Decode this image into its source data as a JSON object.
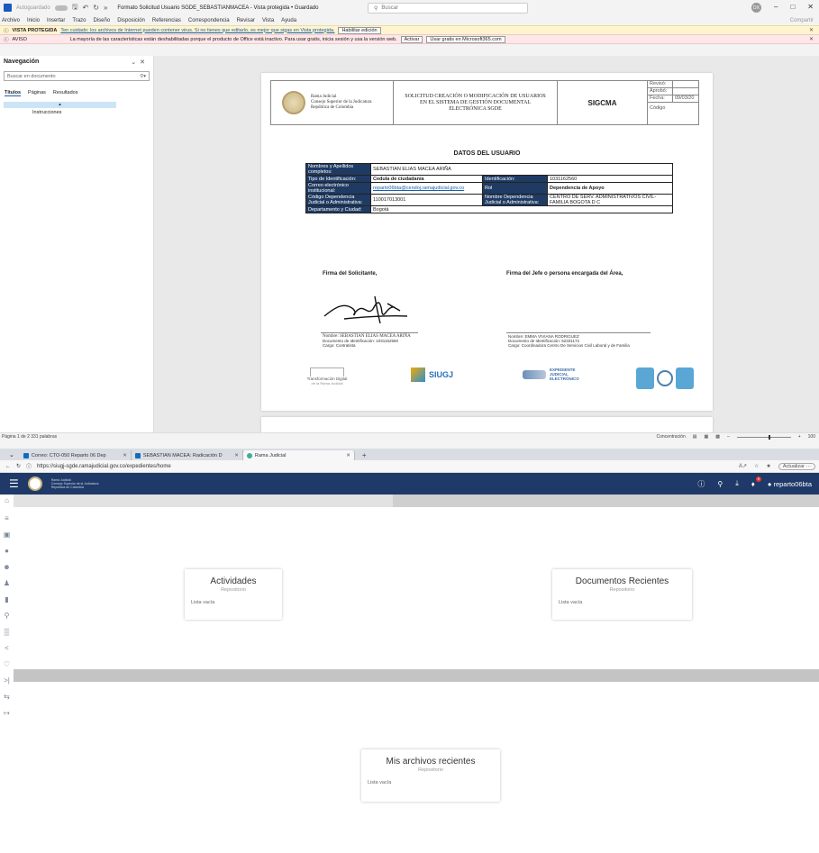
{
  "word": {
    "autosave_label": "Autoguardado",
    "doc_title": "Formato Solicitud Usuario SGDE_SEBASTIANMACEA  -  Vista protegida • Guardado",
    "search_placeholder": "Buscar",
    "avatar_initials": "DX",
    "menu": [
      "Archivo",
      "Inicio",
      "Insertar",
      "Trazo",
      "Diseño",
      "Disposición",
      "Referencias",
      "Correspondencia",
      "Revisar",
      "Vista",
      "Ayuda"
    ],
    "share_label": "Compartir",
    "protected_bar": {
      "tag": "VISTA PROTEGIDA",
      "text": "Ten cuidado: los archivos de Internet pueden contener virus. Si no tienes que editarlo, es mejor que sigas en Vista protegida.",
      "button": "Habilitar edición"
    },
    "notice_bar": {
      "tag": "AVISO",
      "text": "La mayoría de las características están deshabilitadas porque el producto de Office está inactivo. Para usar gratis, inicia sesión y usa la versión web.",
      "btn1": "Activar",
      "btn2": "Usar gratis en Microsoft365.com"
    },
    "nav": {
      "title": "Navegación",
      "search_placeholder": "Buscar en documento",
      "tabs": [
        "Títulos",
        "Páginas",
        "Resultados"
      ],
      "item": "Instrucciones"
    },
    "status": {
      "left": "Página 1 de 2    331 palabras",
      "focus": "Concentración",
      "zoom": "100"
    }
  },
  "document": {
    "entity": [
      "Rama Judicial",
      "Consejo Superior de la Judicatura",
      "República de Colombia"
    ],
    "form_title": "SOLICITUD CREACIÓN O MODIFICACIÓN DE USUARIOS EN EL SISTEMA DE GESTIÓN DOCUMENTAL ELECTRÓNICA SGDE",
    "system": "SIGCMA",
    "meta": {
      "reviso": "Revisó:",
      "aprobo": "Aprobó:",
      "fecha_label": "Fecha:",
      "fecha": "09/03/20",
      "codigo": "Código"
    },
    "section_title": "DATOS DEL USUARIO",
    "table": {
      "nombres_lbl": "Nombres y Apellidos completos:",
      "nombres": "SEBASTIAN ELIAS MACEA ARIÑA",
      "tipo_lbl": "Tipo de Identificación:",
      "tipo": "Cedula de ciudadanía",
      "ident_lbl": "Identificación:",
      "ident": "1031162560",
      "correo_lbl": "Correo electrónico institucional:",
      "correo": "reparto06bta@cendoj.ramajudicial.gov.co",
      "rol_lbl": "Rol",
      "rol": "Dependencia de Apoyo",
      "cod_lbl": "Código Dependencia Judicial o Administrativa:",
      "cod": "110017013001",
      "nomdep_lbl": "Nombre Dependencia Judicial o Administrativa:",
      "nomdep": "CENTRO DE SERV. ADMINISTRATIVOS CIVIL-FAMILIA BOGOTA D C",
      "depto_lbl": "Departamento y Ciudad:",
      "depto": "Bogotá"
    },
    "sig_left_title": "Firma del Solicitante,",
    "sig_right_title": "Firma del Jefe o persona encargada del Área,",
    "sig_left": {
      "nombre": "Nombre:  SEBASTIAN ELIAS MACEA ARIÑA",
      "doc": "Documento de Identificación:  1031162560",
      "cargo": "Cargo: Contratista"
    },
    "sig_right": {
      "nombre": "Nombre: EMMA VIVIANA RODRIGUEZ",
      "doc": "Documento de Identificación: 52331172",
      "cargo": "Cargo: Coordinadora Centro De Servicios Civil Laboral y de Familia"
    },
    "logos": {
      "tdigital": "Transformación Digital",
      "tdigital_sub": "de la Rama Judicial",
      "siugj": "SIUGJ",
      "expediente": "EXPEDIENTE JUDICIAL ELECTRÓNICO"
    }
  },
  "browser": {
    "tabs": [
      {
        "label": "Correo: CTO-050 Reparto 06 Dep"
      },
      {
        "label": "SEBASTIAN MACEA: Radicación D"
      },
      {
        "label": "Rama Judicial"
      }
    ],
    "url": "https://siugj-sgde.ramajudicial.gov.co/expedientes/home",
    "update_label": "Actualizar",
    "user": "reparto06bta",
    "notif_count": "9",
    "cards": {
      "actividades_title": "Actividades",
      "actividades_sub": "Repositorio",
      "actividades_empty": "Lista vacía",
      "documentos_title": "Documentos Recientes",
      "documentos_sub": "Repositorio",
      "documentos_empty": "Lista vacía",
      "archivos_title": "Mis archivos recientes",
      "archivos_sub": "Repositorio",
      "archivos_empty": "Lista vacía"
    }
  }
}
